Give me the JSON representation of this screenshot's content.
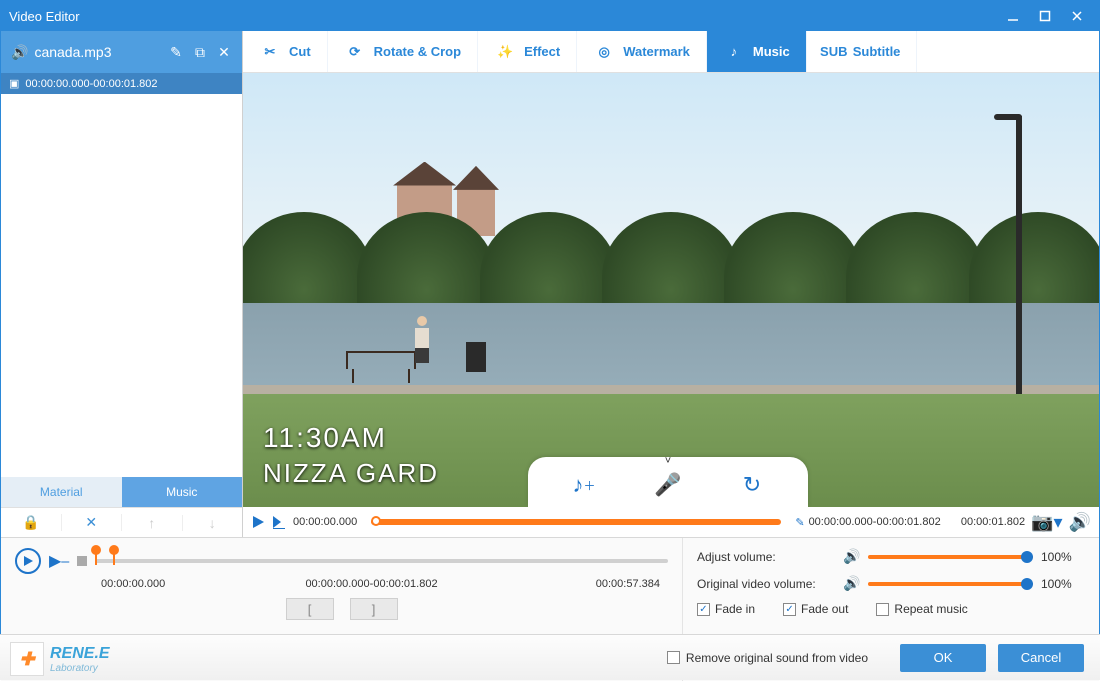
{
  "window": {
    "title": "Video Editor"
  },
  "sidebar": {
    "file_icon": "speaker",
    "file_name": "canada.mp3",
    "item_range": "00:00:00.000-00:00:01.802",
    "tabs": {
      "material": "Material",
      "music": "Music"
    }
  },
  "toolbar": {
    "cut": "Cut",
    "rotate": "Rotate & Crop",
    "effect": "Effect",
    "watermark": "Watermark",
    "music": "Music",
    "subtitle": "Subtitle"
  },
  "preview": {
    "overlay_line1": "11:30AM",
    "overlay_line2": "NIZZA GARD"
  },
  "timeline": {
    "start": "00:00:00.000",
    "range": "00:00:00.000-00:00:01.802",
    "end": "00:00:01.802"
  },
  "music_track": {
    "t0": "00:00:00.000",
    "range": "00:00:00.000-00:00:01.802",
    "tend": "00:00:57.384"
  },
  "options": {
    "adjust_volume_label": "Adjust volume:",
    "adjust_volume_pct": "100%",
    "orig_volume_label": "Original video volume:",
    "orig_volume_pct": "100%",
    "fade_in": "Fade in",
    "fade_out": "Fade out",
    "repeat": "Repeat music",
    "remove_sound": "Remove original sound from video"
  },
  "footer": {
    "brand": "RENE.E",
    "brand_sub": "Laboratory",
    "ok": "OK",
    "cancel": "Cancel"
  }
}
